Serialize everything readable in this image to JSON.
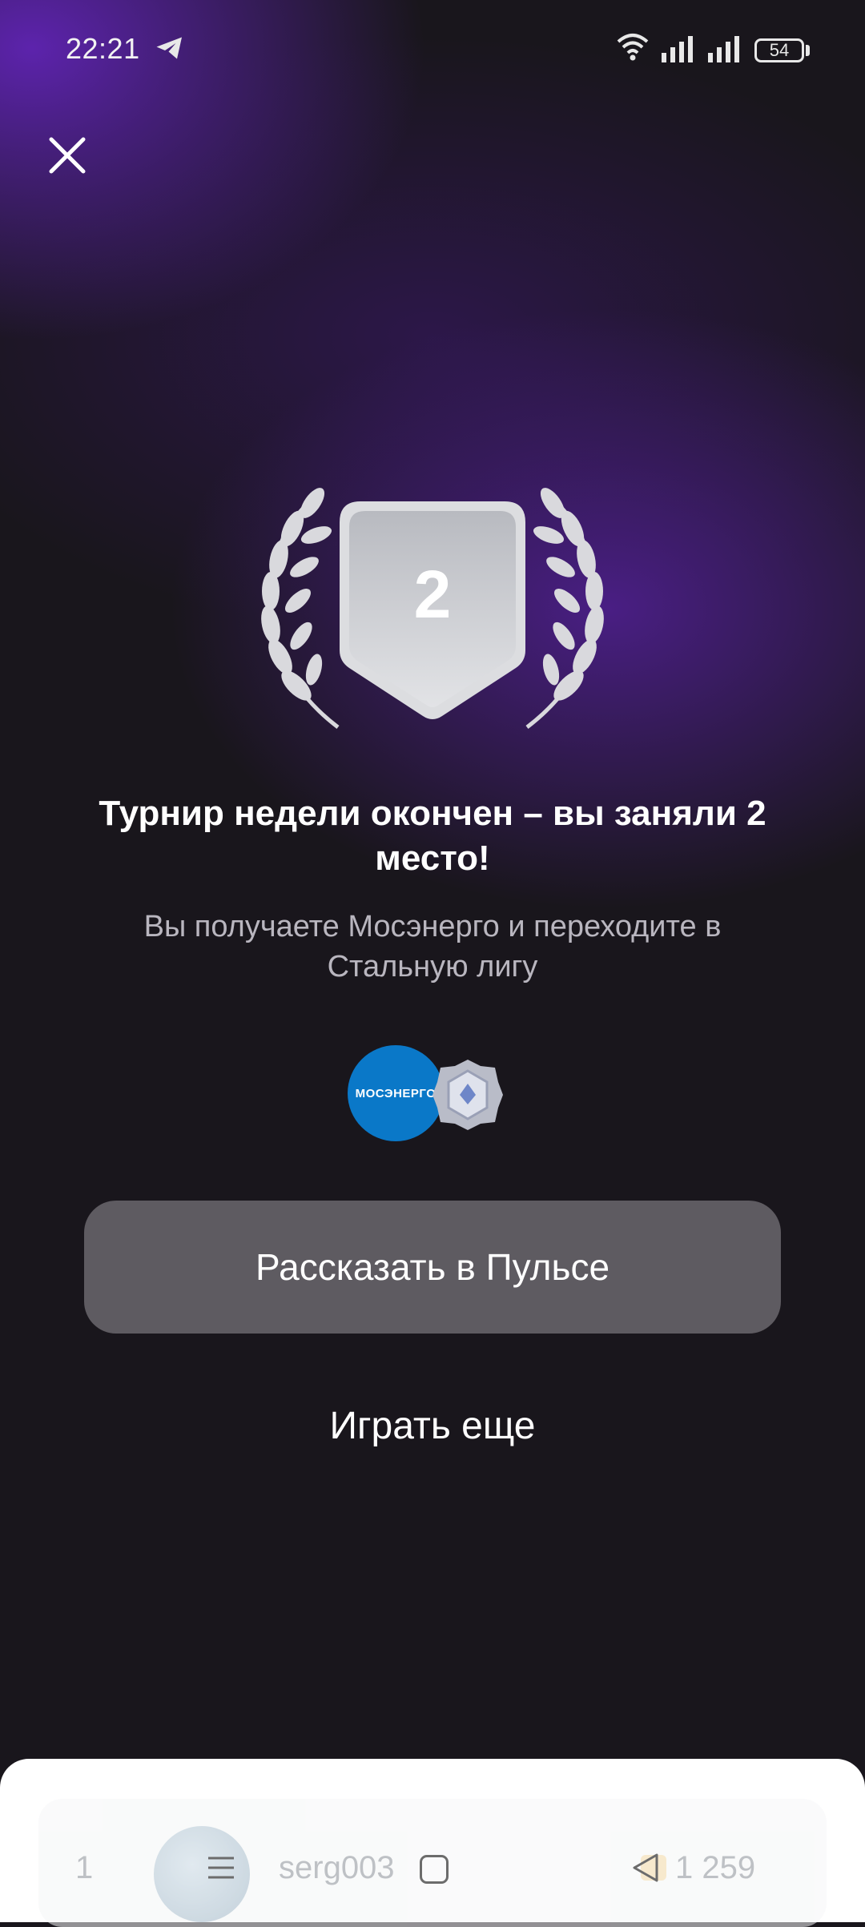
{
  "status_bar": {
    "time": "22:21",
    "battery": "54",
    "icons": [
      "telegram-icon",
      "wifi-icon",
      "signal-icon",
      "signal-icon",
      "battery-icon"
    ]
  },
  "close": {
    "icon": "close-icon"
  },
  "award": {
    "rank": "2",
    "colors": {
      "shield": "#c9cbd0",
      "laurel": "#d9d9dd"
    }
  },
  "headline": "Турнир недели окончен – вы заняли 2 место!",
  "subtitle": "Вы получаете Мосэнерго и переходите в Стальную лигу",
  "rewards": {
    "sponsor_logo_text": "МОСЭНЕРГО",
    "league_badge_icon": "steel-league-badge-icon",
    "sponsor_color": "#0a78c8"
  },
  "buttons": {
    "share_label": "Рассказать в Пульсе",
    "play_again_label": "Играть еще"
  },
  "leaderboard_row": {
    "rank": "1",
    "name": "serg003",
    "score": "1 259"
  },
  "nav": {
    "icons": [
      "menu-icon",
      "home-icon",
      "back-icon"
    ]
  },
  "colors": {
    "background": "#19161c",
    "accent_purple": "#6024b4",
    "button_bg": "#5e5b61"
  }
}
